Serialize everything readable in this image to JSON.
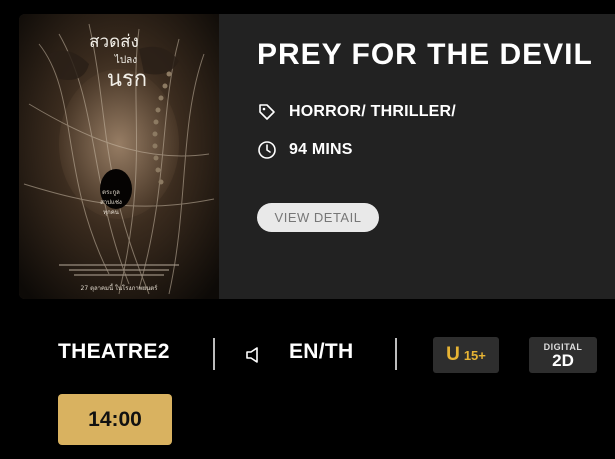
{
  "movie": {
    "title": "PREY FOR THE DEVIL",
    "genre": "HORROR/ THRILLER/",
    "duration": "94 MINS",
    "view_detail_label": "VIEW DETAIL",
    "genre_icon": "tag-icon",
    "duration_icon": "clock-icon"
  },
  "poster": {
    "title_line1": "สวดส่ง",
    "title_line2": "ไปลง",
    "title_line3": "นรก",
    "tagline_line1": "ตระกูล",
    "tagline_line2": "สาปแช่ง",
    "tagline_line3": "ทุกคน",
    "release_text": "27 ตุลาคมนี้ ในโรงภาพยนตร์"
  },
  "showing": {
    "theatre": "THEATRE2",
    "sound_icon": "speaker-icon",
    "language": "EN/TH",
    "rating_letter": "U",
    "rating_age": "15+",
    "format_top": "DIGITAL",
    "format_bottom": "2D",
    "showtimes": [
      "14:00"
    ]
  },
  "colors": {
    "background": "#000000",
    "card": "#222222",
    "rating_accent": "#e7b434",
    "showtime_button": "#d9b260"
  }
}
